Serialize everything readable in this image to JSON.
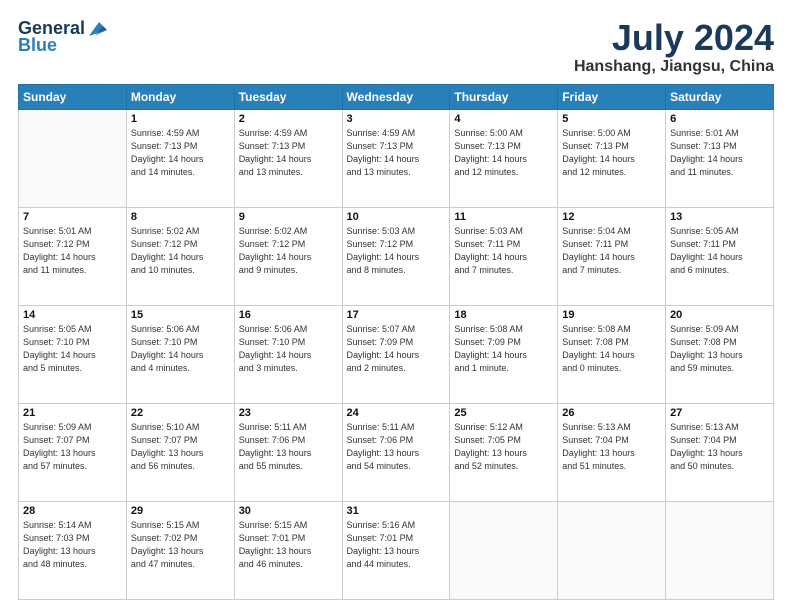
{
  "header": {
    "logo_general": "General",
    "logo_blue": "Blue",
    "month_title": "July 2024",
    "location": "Hanshang, Jiangsu, China"
  },
  "weekdays": [
    "Sunday",
    "Monday",
    "Tuesday",
    "Wednesday",
    "Thursday",
    "Friday",
    "Saturday"
  ],
  "weeks": [
    [
      {
        "day": "",
        "info": ""
      },
      {
        "day": "1",
        "info": "Sunrise: 4:59 AM\nSunset: 7:13 PM\nDaylight: 14 hours\nand 14 minutes."
      },
      {
        "day": "2",
        "info": "Sunrise: 4:59 AM\nSunset: 7:13 PM\nDaylight: 14 hours\nand 13 minutes."
      },
      {
        "day": "3",
        "info": "Sunrise: 4:59 AM\nSunset: 7:13 PM\nDaylight: 14 hours\nand 13 minutes."
      },
      {
        "day": "4",
        "info": "Sunrise: 5:00 AM\nSunset: 7:13 PM\nDaylight: 14 hours\nand 12 minutes."
      },
      {
        "day": "5",
        "info": "Sunrise: 5:00 AM\nSunset: 7:13 PM\nDaylight: 14 hours\nand 12 minutes."
      },
      {
        "day": "6",
        "info": "Sunrise: 5:01 AM\nSunset: 7:13 PM\nDaylight: 14 hours\nand 11 minutes."
      }
    ],
    [
      {
        "day": "7",
        "info": "Sunrise: 5:01 AM\nSunset: 7:12 PM\nDaylight: 14 hours\nand 11 minutes."
      },
      {
        "day": "8",
        "info": "Sunrise: 5:02 AM\nSunset: 7:12 PM\nDaylight: 14 hours\nand 10 minutes."
      },
      {
        "day": "9",
        "info": "Sunrise: 5:02 AM\nSunset: 7:12 PM\nDaylight: 14 hours\nand 9 minutes."
      },
      {
        "day": "10",
        "info": "Sunrise: 5:03 AM\nSunset: 7:12 PM\nDaylight: 14 hours\nand 8 minutes."
      },
      {
        "day": "11",
        "info": "Sunrise: 5:03 AM\nSunset: 7:11 PM\nDaylight: 14 hours\nand 7 minutes."
      },
      {
        "day": "12",
        "info": "Sunrise: 5:04 AM\nSunset: 7:11 PM\nDaylight: 14 hours\nand 7 minutes."
      },
      {
        "day": "13",
        "info": "Sunrise: 5:05 AM\nSunset: 7:11 PM\nDaylight: 14 hours\nand 6 minutes."
      }
    ],
    [
      {
        "day": "14",
        "info": "Sunrise: 5:05 AM\nSunset: 7:10 PM\nDaylight: 14 hours\nand 5 minutes."
      },
      {
        "day": "15",
        "info": "Sunrise: 5:06 AM\nSunset: 7:10 PM\nDaylight: 14 hours\nand 4 minutes."
      },
      {
        "day": "16",
        "info": "Sunrise: 5:06 AM\nSunset: 7:10 PM\nDaylight: 14 hours\nand 3 minutes."
      },
      {
        "day": "17",
        "info": "Sunrise: 5:07 AM\nSunset: 7:09 PM\nDaylight: 14 hours\nand 2 minutes."
      },
      {
        "day": "18",
        "info": "Sunrise: 5:08 AM\nSunset: 7:09 PM\nDaylight: 14 hours\nand 1 minute."
      },
      {
        "day": "19",
        "info": "Sunrise: 5:08 AM\nSunset: 7:08 PM\nDaylight: 14 hours\nand 0 minutes."
      },
      {
        "day": "20",
        "info": "Sunrise: 5:09 AM\nSunset: 7:08 PM\nDaylight: 13 hours\nand 59 minutes."
      }
    ],
    [
      {
        "day": "21",
        "info": "Sunrise: 5:09 AM\nSunset: 7:07 PM\nDaylight: 13 hours\nand 57 minutes."
      },
      {
        "day": "22",
        "info": "Sunrise: 5:10 AM\nSunset: 7:07 PM\nDaylight: 13 hours\nand 56 minutes."
      },
      {
        "day": "23",
        "info": "Sunrise: 5:11 AM\nSunset: 7:06 PM\nDaylight: 13 hours\nand 55 minutes."
      },
      {
        "day": "24",
        "info": "Sunrise: 5:11 AM\nSunset: 7:06 PM\nDaylight: 13 hours\nand 54 minutes."
      },
      {
        "day": "25",
        "info": "Sunrise: 5:12 AM\nSunset: 7:05 PM\nDaylight: 13 hours\nand 52 minutes."
      },
      {
        "day": "26",
        "info": "Sunrise: 5:13 AM\nSunset: 7:04 PM\nDaylight: 13 hours\nand 51 minutes."
      },
      {
        "day": "27",
        "info": "Sunrise: 5:13 AM\nSunset: 7:04 PM\nDaylight: 13 hours\nand 50 minutes."
      }
    ],
    [
      {
        "day": "28",
        "info": "Sunrise: 5:14 AM\nSunset: 7:03 PM\nDaylight: 13 hours\nand 48 minutes."
      },
      {
        "day": "29",
        "info": "Sunrise: 5:15 AM\nSunset: 7:02 PM\nDaylight: 13 hours\nand 47 minutes."
      },
      {
        "day": "30",
        "info": "Sunrise: 5:15 AM\nSunset: 7:01 PM\nDaylight: 13 hours\nand 46 minutes."
      },
      {
        "day": "31",
        "info": "Sunrise: 5:16 AM\nSunset: 7:01 PM\nDaylight: 13 hours\nand 44 minutes."
      },
      {
        "day": "",
        "info": ""
      },
      {
        "day": "",
        "info": ""
      },
      {
        "day": "",
        "info": ""
      }
    ]
  ]
}
